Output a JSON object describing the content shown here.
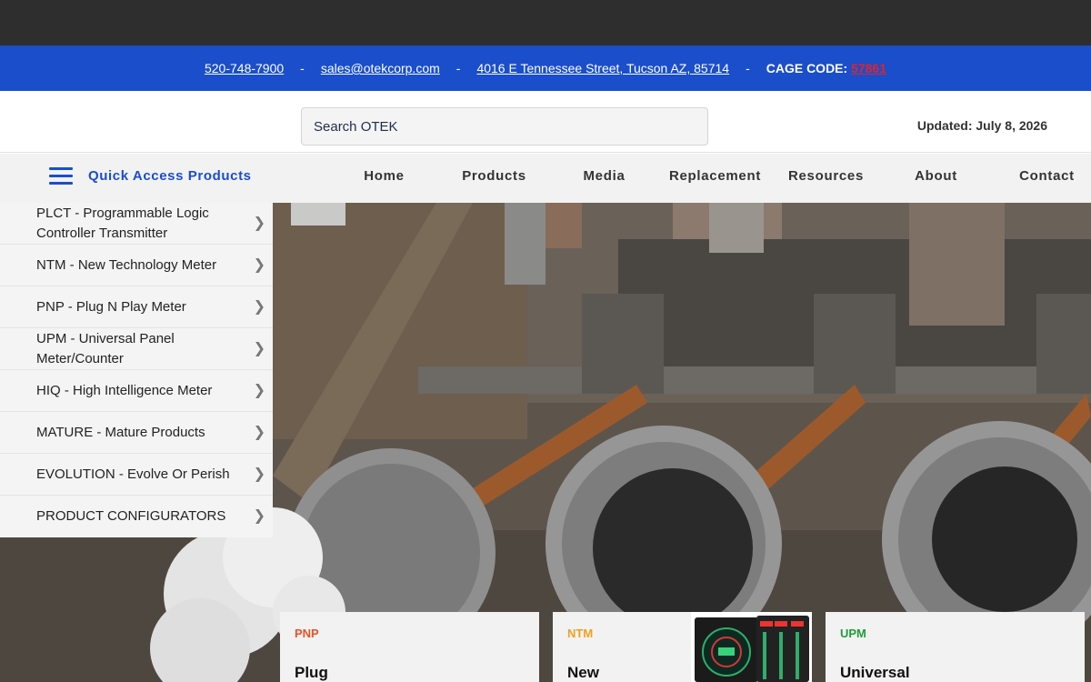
{
  "contact": {
    "phone": "520-748-7900",
    "separator": "-",
    "email": "sales@otekcorp.com",
    "address": "4016 E Tennessee Street, Tucson AZ, 85714",
    "cage_label": "CAGE CODE:",
    "cage_code": "57861"
  },
  "search": {
    "placeholder": "Search OTEK"
  },
  "updated": "Updated: July 8, 2026",
  "nav": {
    "quick_access": "Quick Access Products",
    "items": [
      "Home",
      "Products",
      "Media",
      "Replacement",
      "Resources",
      "About",
      "Contact"
    ]
  },
  "sidemenu": {
    "chevron": "❯",
    "items": [
      "PLCT - Programmable Logic Controller Transmitter",
      "NTM - New Technology Meter",
      "PNP - Plug N Play Meter",
      "UPM - Universal Panel Meter/Counter",
      "HIQ - High Intelligence Meter",
      "MATURE - Mature Products",
      "EVOLUTION - Evolve Or Perish",
      "PRODUCT CONFIGURATORS"
    ]
  },
  "cards": [
    {
      "code": "PNP",
      "title": "Plug",
      "color": "#e8532a"
    },
    {
      "code": "NTM",
      "title": "New",
      "color": "#f0a020"
    },
    {
      "code": "UPM",
      "title": "Universal",
      "color": "#1e9e3a"
    }
  ],
  "colors": {
    "brand_blue": "#1a4ecb",
    "cage_red": "#e0242b",
    "topbar": "#2e2e2e"
  },
  "icons": {
    "menu": "hamburger-menu-icon",
    "chevron": "chevron-right-icon"
  }
}
